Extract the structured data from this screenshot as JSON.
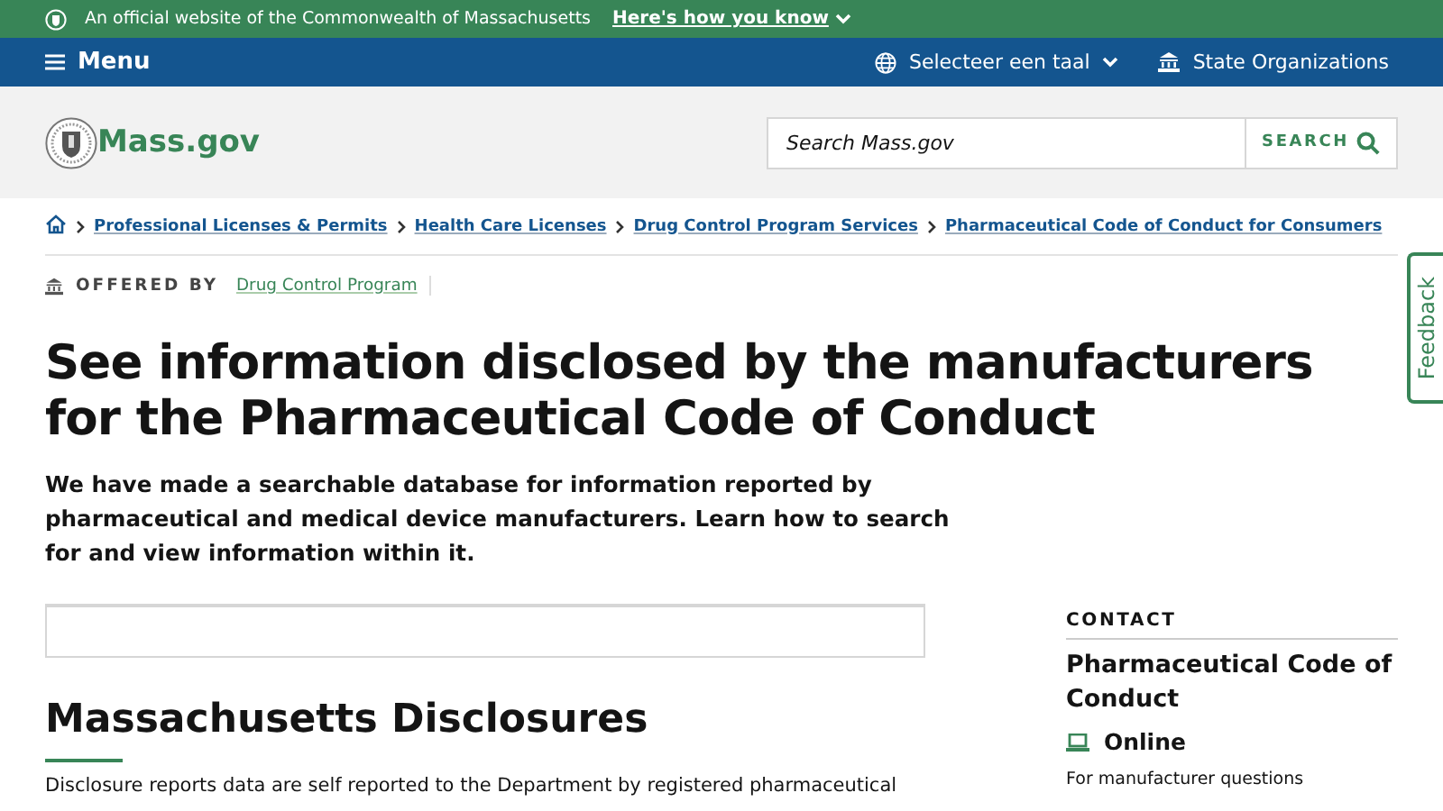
{
  "banner": {
    "text": "An official website of the Commonwealth of Massachusetts",
    "link": "Here's how you know"
  },
  "nav": {
    "menu": "Menu",
    "language": "Selecteer een taal",
    "organizations": "State Organizations"
  },
  "header": {
    "logo_text": "Mass.gov",
    "search_placeholder": "Search Mass.gov",
    "search_button": "SEARCH"
  },
  "breadcrumbs": [
    "Professional Licenses & Permits",
    "Health Care Licenses",
    "Drug Control Program Services",
    "Pharmaceutical Code of Conduct for Consumers"
  ],
  "offered_by": {
    "label": "OFFERED BY",
    "link": "Drug Control Program"
  },
  "title": "See information disclosed by the manufacturers for the Pharmaceutical Code of Conduct",
  "lead": "We have made a searchable database for information reported by pharmaceutical and medical device manufacturers. Learn how to search for and view information within it.",
  "section": {
    "heading": "Massachusetts Disclosures",
    "text": "Disclosure reports data are self reported to the Department by registered pharmaceutical"
  },
  "contact": {
    "label": "CONTACT",
    "name": "Pharmaceutical Code of Conduct",
    "method": "Online",
    "note": "For manufacturer questions"
  },
  "feedback": "Feedback"
}
